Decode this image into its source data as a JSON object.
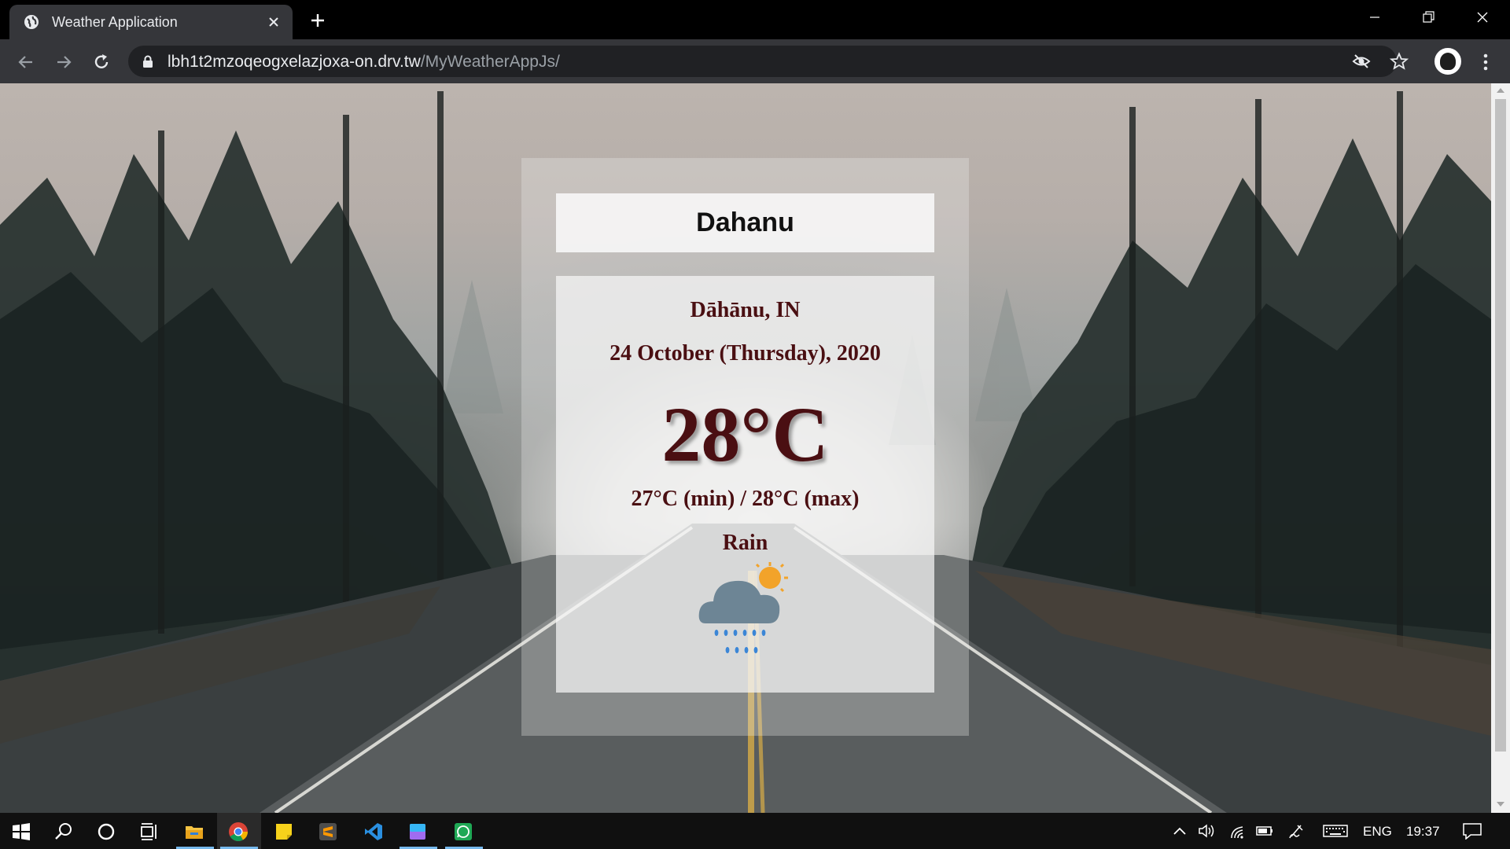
{
  "browser": {
    "tab_title": "Weather Application",
    "url_host": "lbh1t2mzoqeogxelazjoxa-on.drv.tw",
    "url_path": "/MyWeatherAppJs/"
  },
  "weather": {
    "search_value": "Dahanu",
    "city": "Dāhānu, IN",
    "date": "24 October (Thursday), 2020",
    "temperature": "28°C",
    "min_max": "27°C (min) / 28°C (max)",
    "condition": "Rain",
    "icon": "rain-cloud-sun-icon"
  },
  "taskbar": {
    "language": "ENG",
    "time": "19:37",
    "apps": [
      "start",
      "search",
      "cortana",
      "task-view",
      "file-explorer",
      "chrome",
      "sticky-notes",
      "sublime-text",
      "vscode",
      "paint-3d",
      "whatsapp"
    ]
  },
  "colors": {
    "text_primary": "#4a0f12",
    "browser_dark": "#35363a",
    "taskbar": "#101010"
  }
}
